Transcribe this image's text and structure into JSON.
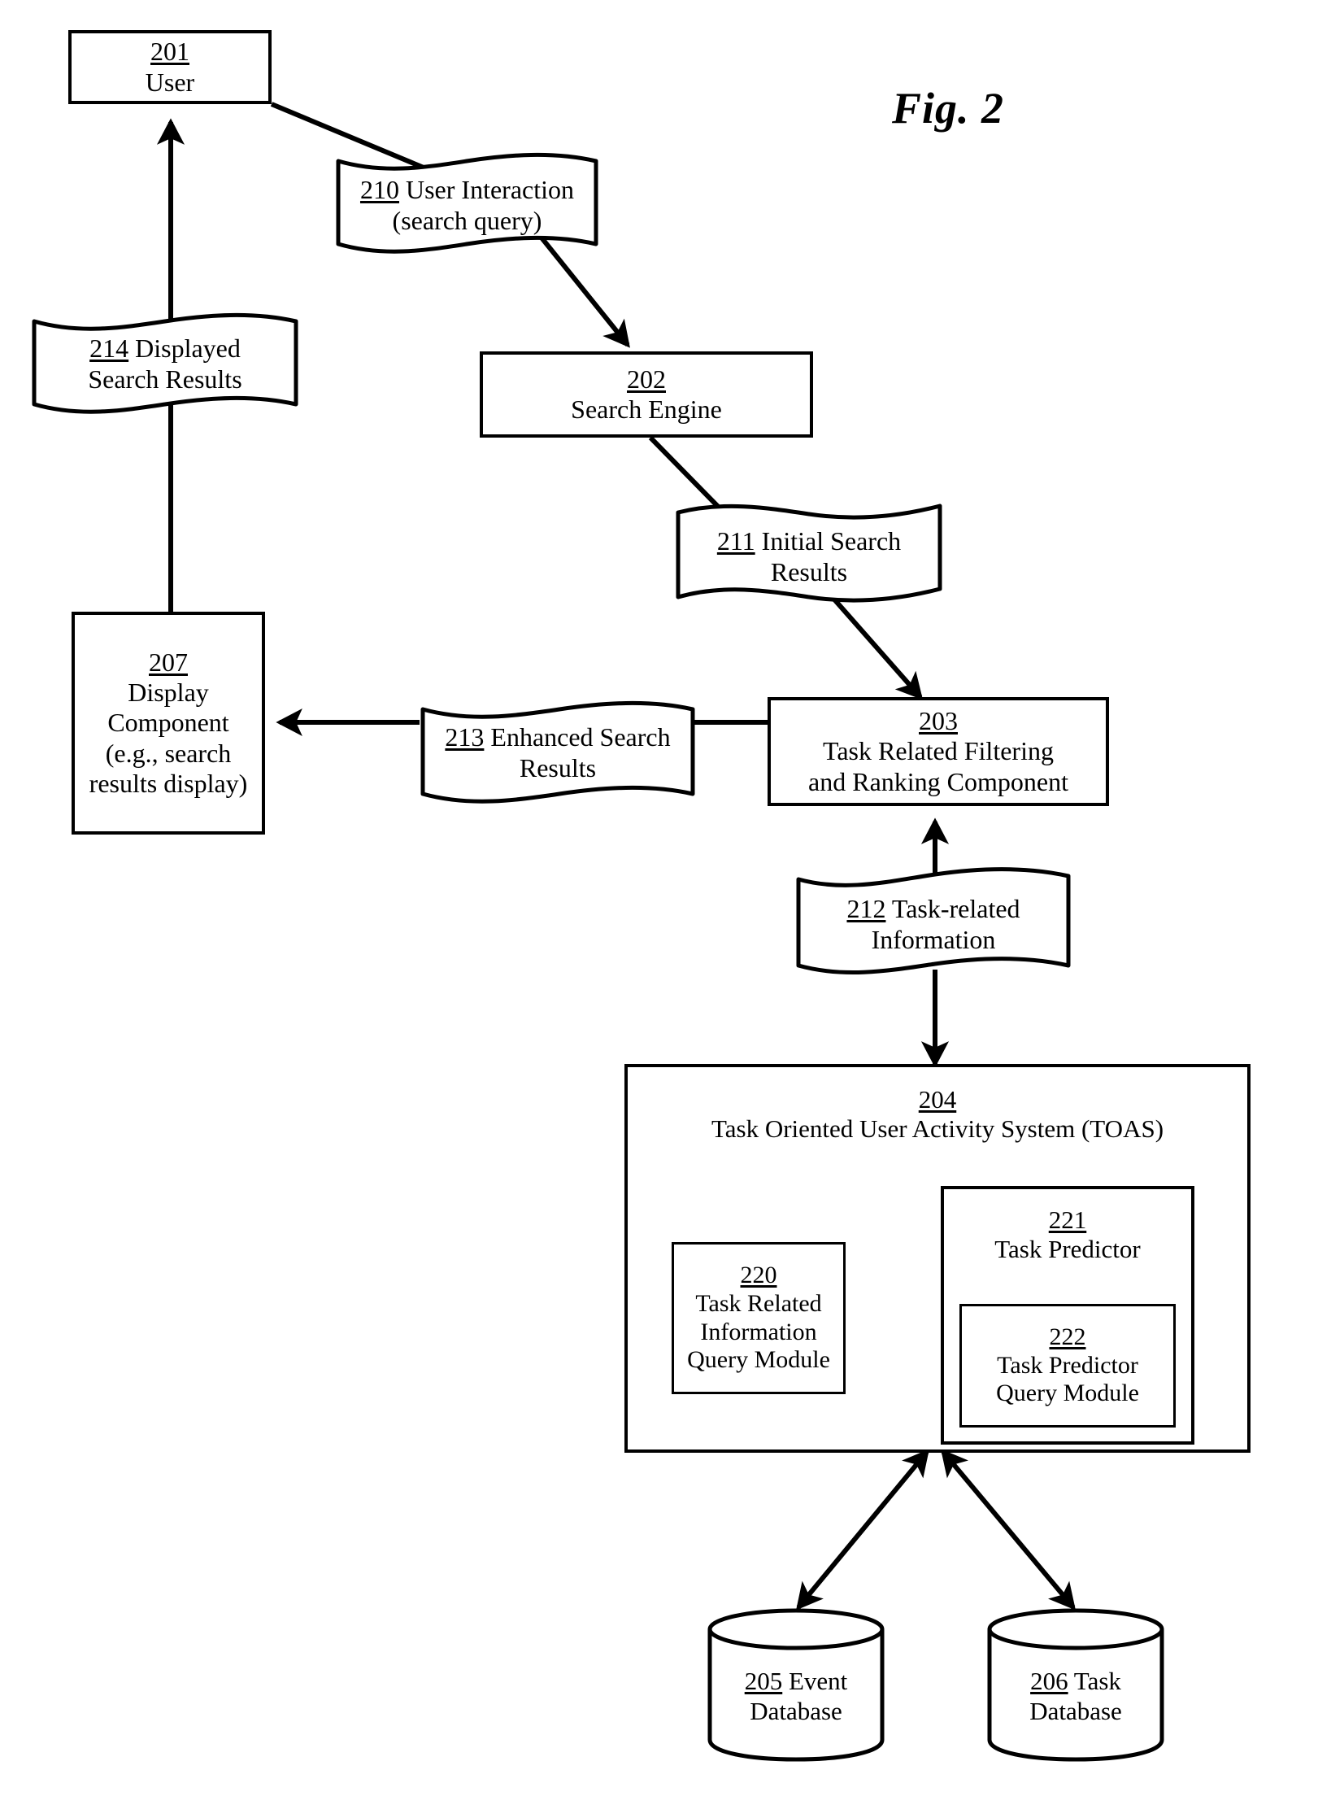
{
  "figure": {
    "title": "Fig. 2",
    "nodes": {
      "user": {
        "ref": "201",
        "label": "User"
      },
      "search_engine": {
        "ref": "202",
        "label": "Search Engine"
      },
      "filter_rank": {
        "ref": "203",
        "line1": "Task Related Filtering",
        "line2": "and Ranking Component"
      },
      "toas": {
        "ref": "204",
        "label": "Task Oriented User Activity System (TOAS)"
      },
      "event_db": {
        "ref": "205",
        "line1": "Event",
        "line2": "Database"
      },
      "task_db": {
        "ref": "206",
        "line1": "Task",
        "line2": "Database"
      },
      "display_component": {
        "ref": "207",
        "line1": "Display",
        "line2": "Component",
        "line3": "(e.g., search",
        "line4": "results display)"
      },
      "tri_query_module": {
        "ref": "220",
        "line1": "Task Related",
        "line2": "Information",
        "line3": "Query Module"
      },
      "task_predictor": {
        "ref": "221",
        "label": "Task Predictor"
      },
      "task_predictor_query_module": {
        "ref": "222",
        "line1": "Task Predictor",
        "line2": "Query Module"
      }
    },
    "flows": {
      "user_interaction": {
        "ref": "210",
        "line1": "User Interaction",
        "line2": "(search query)"
      },
      "initial_results": {
        "ref": "211",
        "line1": "Initial Search",
        "line2": "Results"
      },
      "task_related_info": {
        "ref": "212",
        "line1": "Task-related",
        "line2": "Information"
      },
      "enhanced_results": {
        "ref": "213",
        "line1": "Enhanced Search",
        "line2": "Results"
      },
      "displayed_results": {
        "ref": "214",
        "line1": "Displayed",
        "line2": "Search Results"
      }
    },
    "colors": {
      "ink": "#000000",
      "paper": "#ffffff"
    }
  }
}
